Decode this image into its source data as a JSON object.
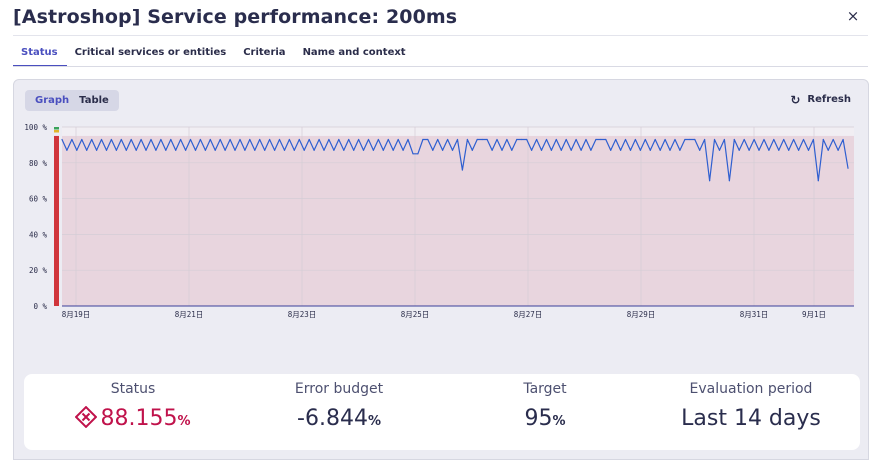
{
  "header": {
    "title": "[Astroshop] Service performance: 200ms",
    "close_label": "×"
  },
  "tabs": [
    {
      "label": "Status",
      "active": true
    },
    {
      "label": "Critical services or entities",
      "active": false
    },
    {
      "label": "Criteria",
      "active": false
    },
    {
      "label": "Name and context",
      "active": false
    }
  ],
  "view_toggle": {
    "graph_label": "Graph",
    "table_label": "Table",
    "selected": "Graph"
  },
  "refresh": {
    "label": "Refresh",
    "icon": "refresh-icon"
  },
  "chart_data": {
    "type": "line",
    "ylim": [
      0,
      100
    ],
    "yticks": [
      "0 %",
      "20 %",
      "40 %",
      "60 %",
      "80 %",
      "100 %"
    ],
    "xticks": [
      "8月19日",
      "8月21日",
      "8月23日",
      "8月25日",
      "8月27日",
      "8月29日",
      "8月31日",
      "9月1日"
    ],
    "target": 95,
    "status_bar": {
      "value": 95,
      "color": "#d0353b"
    },
    "colors": {
      "line": "#2f5fd0",
      "below_target_fill": "#e8d5de",
      "grid": "#d4cdd6"
    },
    "series": [
      {
        "values": [
          93,
          87,
          93,
          87,
          93,
          87,
          93,
          87,
          93,
          87,
          93,
          87,
          93,
          87,
          93,
          87,
          93,
          87,
          93,
          87,
          93,
          87,
          93,
          87,
          93,
          87,
          93,
          87,
          93,
          87,
          93,
          87,
          93,
          87,
          93,
          87,
          93,
          87,
          93,
          87,
          93,
          87,
          93,
          87,
          93,
          87,
          93,
          87,
          93,
          87,
          93,
          87,
          93,
          87,
          93,
          87,
          93,
          87,
          93,
          87,
          93,
          87,
          93,
          87,
          93,
          87,
          93,
          87,
          93,
          87,
          93,
          85,
          85,
          93,
          93,
          87,
          93,
          87,
          93,
          87,
          93,
          76,
          93,
          87,
          93,
          93,
          93,
          87,
          93,
          87,
          93,
          87,
          93,
          93,
          93,
          87,
          93,
          87,
          93,
          87,
          93,
          87,
          93,
          87,
          93,
          87,
          93,
          87,
          93,
          93,
          93,
          87,
          93,
          87,
          93,
          87,
          93,
          87,
          93,
          87,
          93,
          87,
          93,
          87,
          93,
          87,
          93,
          93,
          93,
          87,
          93,
          70,
          93,
          87,
          93,
          70,
          93,
          87,
          93,
          87,
          93,
          87,
          93,
          87,
          93,
          87,
          93,
          87,
          93,
          87,
          93,
          87,
          93,
          70,
          93,
          87,
          93,
          87,
          93,
          77
        ]
      }
    ]
  },
  "stats": [
    {
      "label": "Status",
      "value": "88.155",
      "unit": "%",
      "state": "failure",
      "icon": "failure-diamond-icon"
    },
    {
      "label": "Error budget",
      "value": "-6.844",
      "unit": "%"
    },
    {
      "label": "Target",
      "value": "95",
      "unit": "%"
    },
    {
      "label": "Evaluation period",
      "value": "Last 14 days",
      "unit": ""
    }
  ]
}
